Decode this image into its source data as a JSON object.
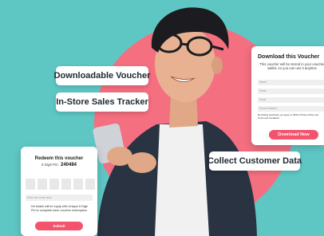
{
  "features": {
    "downloadable_voucher": "Downloadable Voucher",
    "sales_tracker": "In-Store Sales Tracker",
    "collect_data": "Collect Customer Data"
  },
  "redeem_card": {
    "title": "Redeem this voucher",
    "pin_label": "6 Digit Pin:",
    "pin_value": "240484",
    "code_placeholder": "Enter the code here",
    "note": "Yet retails will be equip with Unique 6 Digit Pin to complete each voucher redemption",
    "submit_label": "Submit"
  },
  "download_card": {
    "title": "Download this Voucher",
    "description": "This voucher will be stored in your voucher wallet, so you can use it anytime",
    "fields": [
      "Name",
      "Email",
      "Email",
      "Phone Number"
    ],
    "consent": "By clicking download, you agree to What's Privacy Policy and Terms and Conditions",
    "button_label": "Download Now"
  },
  "colors": {
    "background": "#5ec7c4",
    "circle": "#f46f80",
    "accent_button": "#f4536d"
  }
}
